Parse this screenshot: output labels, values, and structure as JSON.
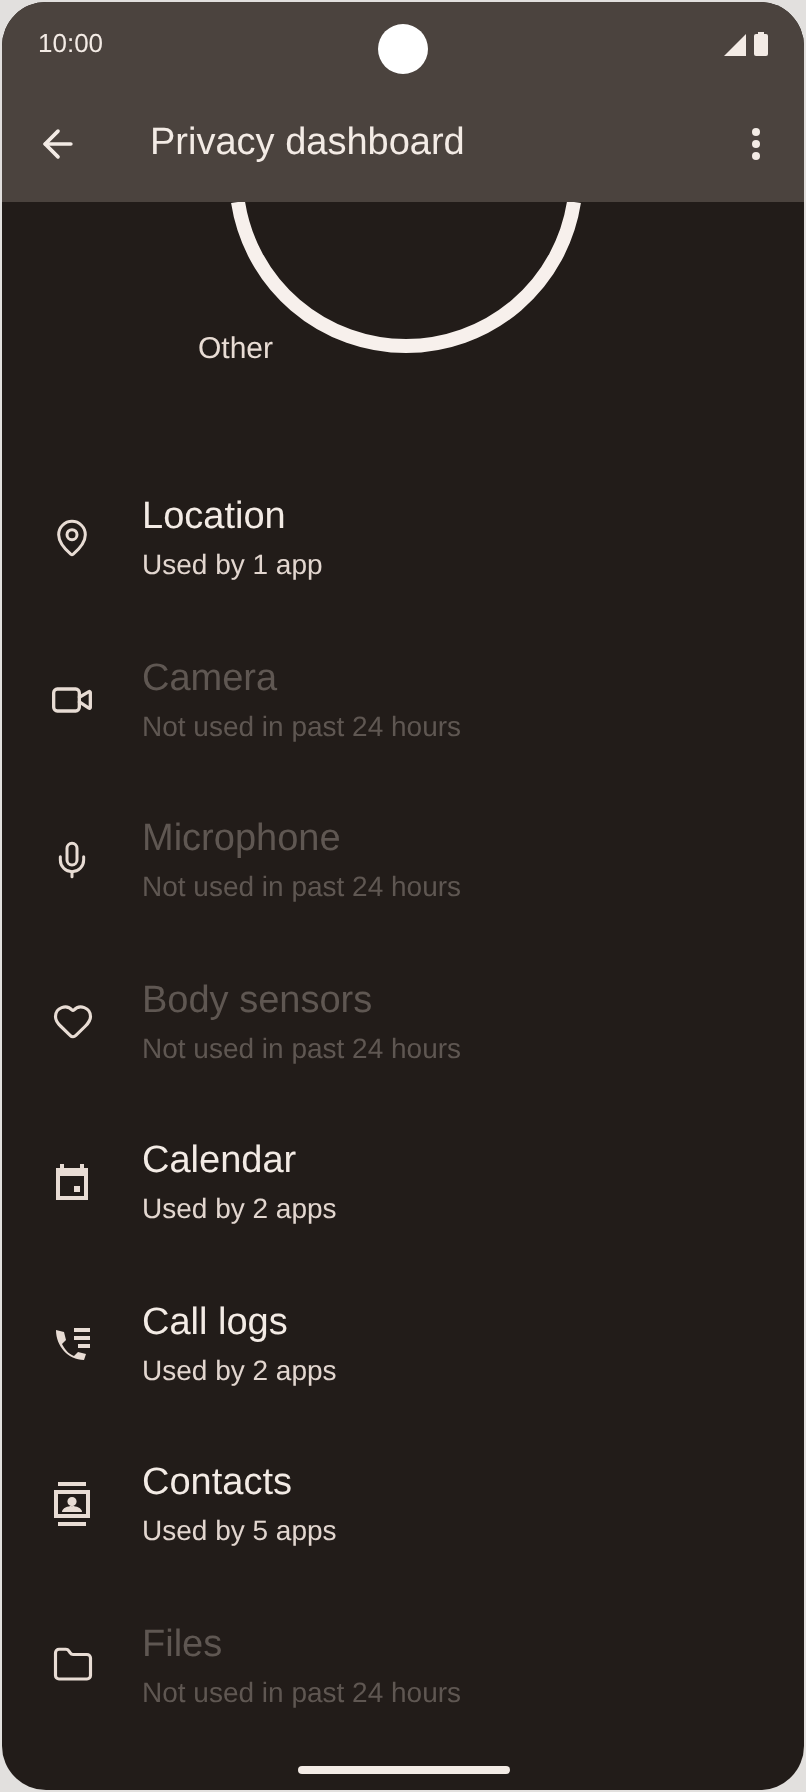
{
  "status_bar": {
    "time": "10:00"
  },
  "app_bar": {
    "title": "Privacy dashboard"
  },
  "chart": {
    "label": "Other"
  },
  "permissions": [
    {
      "kind": "location",
      "title": "Location",
      "subtitle": "Used by 1 app",
      "disabled": false
    },
    {
      "kind": "camera",
      "title": "Camera",
      "subtitle": "Not used in past 24 hours",
      "disabled": true
    },
    {
      "kind": "microphone",
      "title": "Microphone",
      "subtitle": "Not used in past 24 hours",
      "disabled": true
    },
    {
      "kind": "body_sensors",
      "title": "Body sensors",
      "subtitle": "Not used in past 24 hours",
      "disabled": true
    },
    {
      "kind": "calendar",
      "title": "Calendar",
      "subtitle": "Used by 2 apps",
      "disabled": false
    },
    {
      "kind": "call_logs",
      "title": "Call logs",
      "subtitle": "Used by 2 apps",
      "disabled": false
    },
    {
      "kind": "contacts",
      "title": "Contacts",
      "subtitle": "Used by 5 apps",
      "disabled": false
    },
    {
      "kind": "files",
      "title": "Files",
      "subtitle": "Not used in past 24 hours",
      "disabled": true
    }
  ]
}
